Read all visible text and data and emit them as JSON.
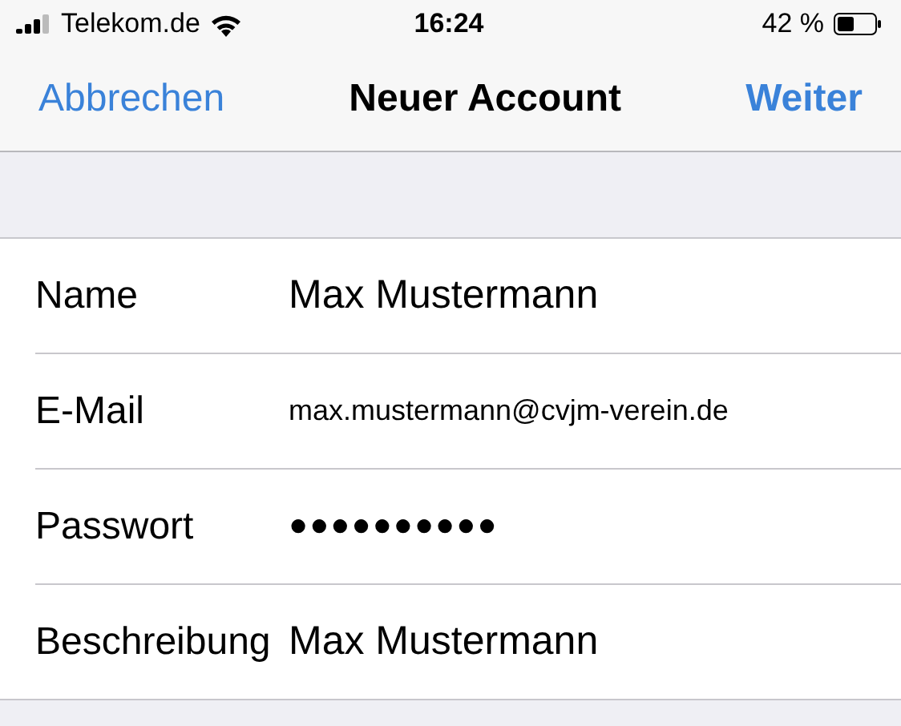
{
  "status_bar": {
    "carrier": "Telekom.de",
    "time": "16:24",
    "battery": "42 %"
  },
  "nav": {
    "cancel": "Abbrechen",
    "title": "Neuer Account",
    "next": "Weiter"
  },
  "fields": [
    {
      "label": "Name",
      "value": "Max Mustermann",
      "kind": "text"
    },
    {
      "label": "E-Mail",
      "value": "max.mustermann@cvjm-verein.de",
      "kind": "email"
    },
    {
      "label": "Passwort",
      "value": "●●●●●●●●●●",
      "kind": "password"
    },
    {
      "label": "Beschreibung",
      "value": "Max Mustermann",
      "kind": "text"
    }
  ]
}
